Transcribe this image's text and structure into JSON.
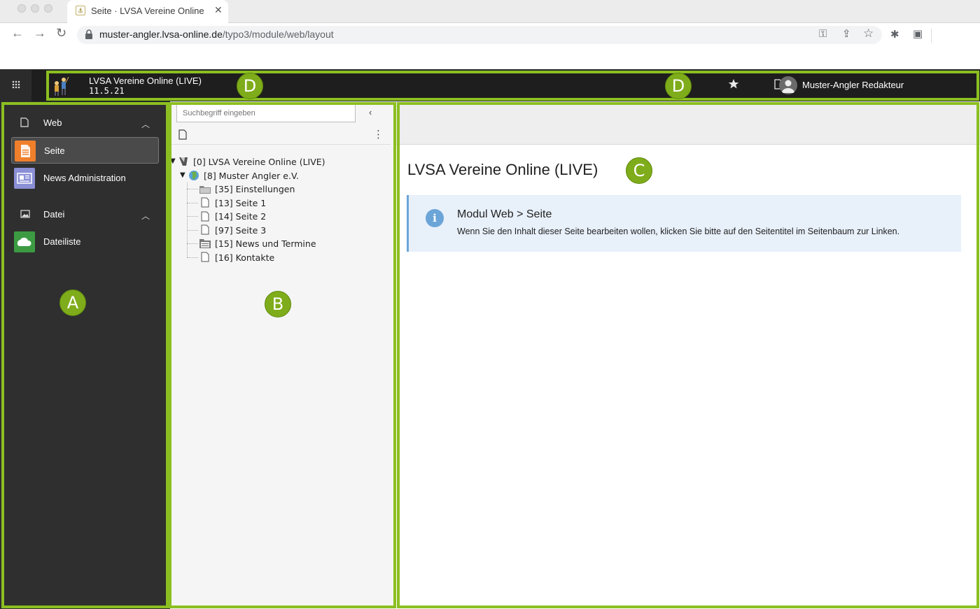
{
  "browser": {
    "tab_title": "Seite · LVSA Vereine Online (LIVE)",
    "url_host": "muster-angler.lvsa-online.de",
    "url_path": "/typo3/module/web/layout"
  },
  "topbar": {
    "site_name": "LVSA Vereine Online (LIVE)",
    "version": "11.5.21",
    "user_name": "Muster-Angler Redakteur"
  },
  "module_menu": {
    "groups": [
      {
        "label": "Web",
        "items": [
          {
            "label": "Seite",
            "active": true
          },
          {
            "label": "News Administration",
            "active": false
          }
        ]
      },
      {
        "label": "Datei",
        "items": [
          {
            "label": "Dateiliste",
            "active": false
          }
        ]
      }
    ]
  },
  "page_tree": {
    "search_placeholder": "Suchbegriff eingeben",
    "nodes": [
      {
        "label": "[0] LVSA Vereine Online (LIVE)",
        "icon": "typo3-root-icon"
      },
      {
        "label": "[8] Muster Angler e.V.",
        "icon": "globe-icon"
      },
      {
        "label": "[35] Einstellungen",
        "icon": "folder-icon"
      },
      {
        "label": "[13] Seite 1",
        "icon": "page-icon"
      },
      {
        "label": "[14] Seite 2",
        "icon": "page-icon"
      },
      {
        "label": "[97] Seite 3",
        "icon": "page-icon"
      },
      {
        "label": "[15] News und Termine",
        "icon": "news-folder-icon"
      },
      {
        "label": "[16] Kontakte",
        "icon": "page-icon"
      }
    ]
  },
  "content": {
    "page_title": "LVSA Vereine Online (LIVE)",
    "callout_title": "Modul Web > Seite",
    "callout_text": "Wenn Sie den Inhalt dieser Seite bearbeiten wollen, klicken Sie bitte auf den Seitentitel im Seitenbaum zur Linken."
  },
  "markers": {
    "a": "A",
    "b": "B",
    "c": "C",
    "d": "D"
  },
  "colors": {
    "marker_green": "#7fac1a",
    "frame_green": "#8cbf21",
    "callout_blue": "#6ba5d8"
  }
}
